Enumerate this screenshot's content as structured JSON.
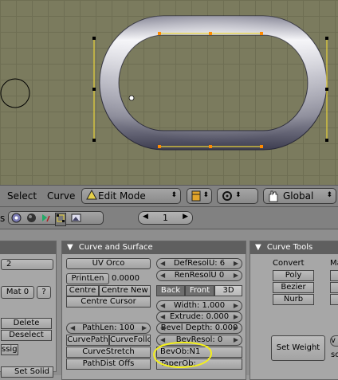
{
  "header": {
    "menus": [
      "Select",
      "Curve"
    ],
    "mode": "Edit Mode",
    "orientation": "Global"
  },
  "buttons_header": {
    "partial_label": "s",
    "frame_number": "1"
  },
  "panel_left": {
    "field_value": "2",
    "mat_label": "Mat 0",
    "question": "?",
    "delete_label": "Delete",
    "deselect_label": "Deselect",
    "assign_label": "ssign",
    "set_solid_label": "Set Solid"
  },
  "curve_surface": {
    "title": "Curve and Surface",
    "uv_orco": "UV Orco",
    "print_len": "PrintLen",
    "print_len_value": "0.0000",
    "centre": "Centre",
    "centre_new": "Centre New",
    "centre_cursor": "Centre Cursor",
    "def_resol_u": "DefResolU: 6",
    "ren_resol_u": "RenResolU 0",
    "back": "Back",
    "front": "Front",
    "three_d": "3D",
    "width": "Width: 1.000",
    "extrude": "Extrude: 0.000",
    "bevel_depth": "Bevel Depth: 0.000",
    "bev_resol": "BevResol: 0",
    "path_len": "PathLen: 100",
    "curve_path": "CurvePath",
    "curve_follow": "CurveFollo",
    "curve_stretch": "CurveStretch",
    "path_dist_offs": "PathDist Offs",
    "bev_ob": "BevOb:N1",
    "taper_ob": "TaperOb:"
  },
  "curve_tools": {
    "title": "Curve Tools",
    "convert": "Convert",
    "poly": "Poly",
    "bezier": "Bezier",
    "nurb": "Nurb",
    "set_weight": "Set Weight",
    "partial_ma": "Ma",
    "partial_v": "v",
    "partial_so": "so"
  },
  "colors": {
    "viewport_bg": "#7b7b5e",
    "grid": "#6e6e53",
    "curve_handles": "#e8d23a",
    "highlight_circle": "#f4f01a",
    "selected_vertex": "#ff8a00"
  }
}
